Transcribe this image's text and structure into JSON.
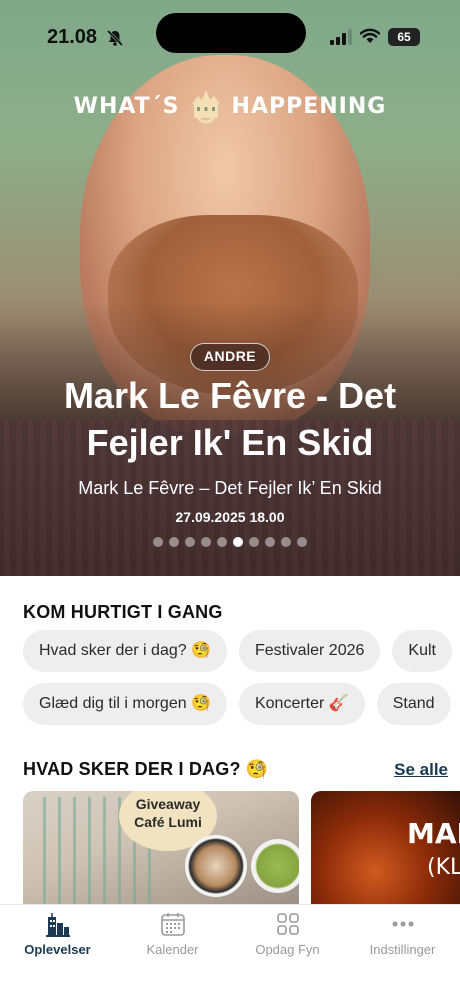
{
  "status_bar": {
    "time": "21.08",
    "battery": "65"
  },
  "hero": {
    "logo_left": "WHAT´S",
    "logo_right": "HAPPENING",
    "category_tag": "ANDRE",
    "title": "Mark Le Fêvre - Det Fejler Ik' En Skid",
    "subtitle": "Mark Le Fêvre – Det Fejler Ik’ En Skid",
    "date": "27.09.2025 18.00",
    "carousel": {
      "count": 10,
      "active_index": 5
    }
  },
  "quick": {
    "title": "KOM HURTIGT I GANG",
    "row1": [
      "Hvad sker der i dag? 🧐",
      "Festivaler 2026",
      "Kult"
    ],
    "row2": [
      "Glæd dig til i morgen 🧐",
      "Koncerter 🎸",
      "Stand"
    ]
  },
  "today": {
    "title": "HVAD SKER DER I DAG? 🧐",
    "see_all": "Se alle",
    "cards": [
      {
        "image_text": "Giveaway Café Lumi"
      },
      {
        "image_text_1": "MAN",
        "image_text_2": "(KL"
      }
    ]
  },
  "tabbar": {
    "tabs": [
      {
        "label": "Oplevelser",
        "icon": "city-icon",
        "active": true
      },
      {
        "label": "Kalender",
        "icon": "calendar-icon",
        "active": false
      },
      {
        "label": "Opdag Fyn",
        "icon": "grid-icon",
        "active": false
      },
      {
        "label": "Indstillinger",
        "icon": "more-icon",
        "active": false
      }
    ]
  },
  "colors": {
    "accent_dark": "#1d3a52",
    "chip_bg": "#eeeeee",
    "tab_inactive": "#9a9a9a"
  }
}
